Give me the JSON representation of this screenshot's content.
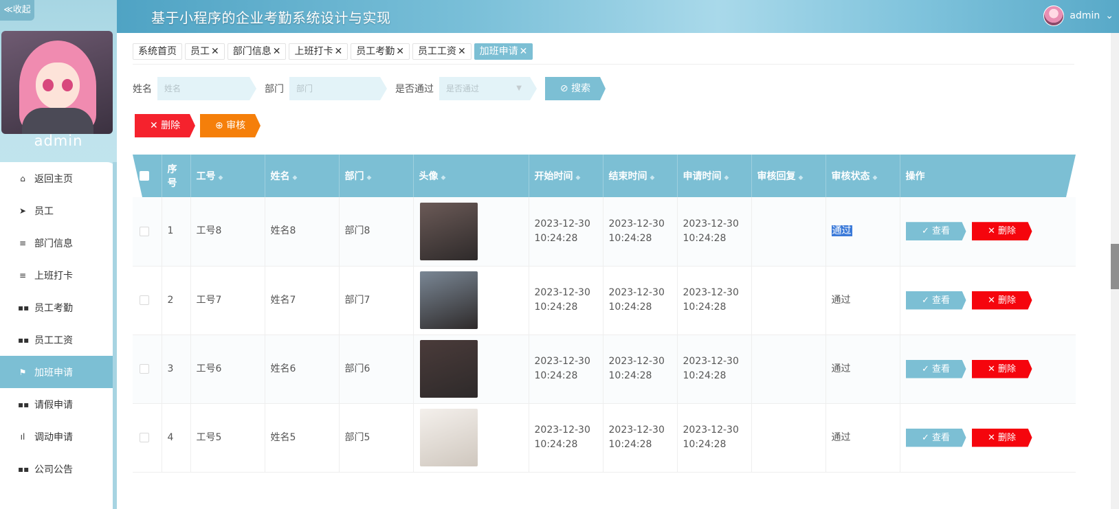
{
  "header": {
    "collapse_label": "≪收起",
    "title": "基于小程序的企业考勤系统设计与实现",
    "user": "admin",
    "user_caret": "⌄"
  },
  "sidebar": {
    "username": "admin",
    "items": [
      {
        "label": "返回主页",
        "icon": "home-icon",
        "glyph": "⌂"
      },
      {
        "label": "员工",
        "icon": "send-icon",
        "glyph": "➤"
      },
      {
        "label": "部门信息",
        "icon": "list-icon",
        "glyph": "≡"
      },
      {
        "label": "上班打卡",
        "icon": "list-icon",
        "glyph": "≡"
      },
      {
        "label": "员工考勤",
        "icon": "grid-icon",
        "glyph": "▪▪"
      },
      {
        "label": "员工工资",
        "icon": "grid-icon",
        "glyph": "▪▪"
      },
      {
        "label": "加班申请",
        "icon": "flag-icon",
        "glyph": "⚑"
      },
      {
        "label": "请假申请",
        "icon": "grid-icon",
        "glyph": "▪▪"
      },
      {
        "label": "调动申请",
        "icon": "bar-chart-icon",
        "glyph": "ıl"
      },
      {
        "label": "公司公告",
        "icon": "grid-icon",
        "glyph": "▪▪"
      }
    ],
    "active_index": 6
  },
  "tabs": [
    {
      "label": "系统首页",
      "closable": false
    },
    {
      "label": "员工",
      "closable": true
    },
    {
      "label": "部门信息",
      "closable": true
    },
    {
      "label": "上班打卡",
      "closable": true
    },
    {
      "label": "员工考勤",
      "closable": true
    },
    {
      "label": "员工工资",
      "closable": true
    },
    {
      "label": "加班申请",
      "closable": true,
      "active": true
    }
  ],
  "tab_close": "✕",
  "search": {
    "name_label": "姓名",
    "name_placeholder": "姓名",
    "dept_label": "部门",
    "dept_placeholder": "部门",
    "pass_label": "是否通过",
    "pass_placeholder": "是否通过",
    "button_label": "⊘ 搜索"
  },
  "actions": {
    "delete_label": "✕ 删除",
    "audit_label": "⊕ 审核"
  },
  "table": {
    "columns": [
      "",
      "序号",
      "工号",
      "姓名",
      "部门",
      "头像",
      "开始时间",
      "结束时间",
      "申请时间",
      "审核回复",
      "审核状态",
      "操作"
    ],
    "sort_glyph": "◆",
    "view_label": "✓ 查看",
    "delete_label": "✕ 删除",
    "rows": [
      {
        "no": "1",
        "emp_id": "工号8",
        "name": "姓名8",
        "dept": "部门8",
        "start": "2023-12-30 10:24:28",
        "end": "2023-12-30 10:24:28",
        "apply": "2023-12-30 10:24:28",
        "reply": "",
        "status": "通过",
        "photo": "#6b5a57"
      },
      {
        "no": "2",
        "emp_id": "工号7",
        "name": "姓名7",
        "dept": "部门7",
        "start": "2023-12-30 10:24:28",
        "end": "2023-12-30 10:24:28",
        "apply": "2023-12-30 10:24:28",
        "reply": "",
        "status": "通过",
        "photo": "#7a8795"
      },
      {
        "no": "3",
        "emp_id": "工号6",
        "name": "姓名6",
        "dept": "部门6",
        "start": "2023-12-30 10:24:28",
        "end": "2023-12-30 10:24:28",
        "apply": "2023-12-30 10:24:28",
        "reply": "",
        "status": "通过",
        "photo": "#4a3b3a"
      },
      {
        "no": "4",
        "emp_id": "工号5",
        "name": "姓名5",
        "dept": "部门5",
        "start": "2023-12-30 10:24:28",
        "end": "2023-12-30 10:24:28",
        "apply": "2023-12-30 10:24:28",
        "reply": "",
        "status": "通过",
        "photo": "#e9e4df"
      }
    ]
  }
}
